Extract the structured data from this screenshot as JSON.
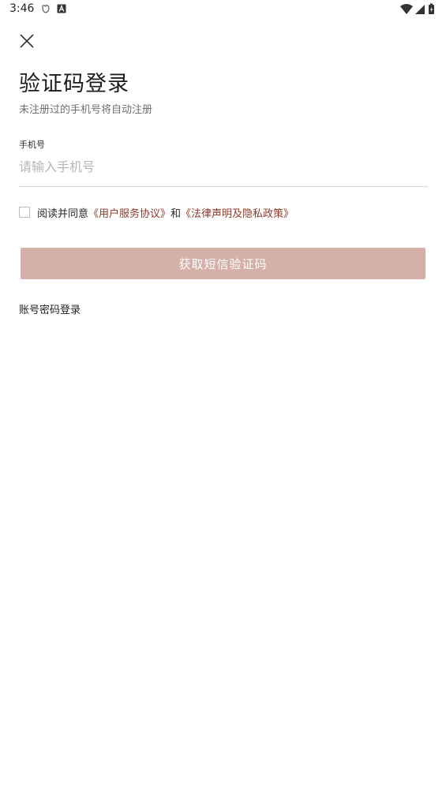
{
  "status_bar": {
    "time": "3:46",
    "notif_icons": [
      "shield-notification-icon",
      "font-a-notification-icon"
    ],
    "right_icons": [
      "wifi-icon",
      "cellular-signal-icon",
      "battery-charging-icon"
    ]
  },
  "header": {
    "close_icon": "close-icon",
    "title": "验证码登录",
    "subtitle": "未注册过的手机号将自动注册"
  },
  "form": {
    "phone_label": "手机号",
    "phone_placeholder": "请输入手机号",
    "phone_value": ""
  },
  "agreement": {
    "checked": false,
    "prefix": "阅读并同意",
    "link_user": "《用户服务协议》",
    "connector": "和",
    "link_legal": "《法律声明及隐私政策》"
  },
  "actions": {
    "sms_button_label": "获取短信验证码",
    "password_login_label": "账号密码登录"
  },
  "colors": {
    "accent_link": "#8e3b2b",
    "button_bg_disabled": "#d5b0a8"
  }
}
